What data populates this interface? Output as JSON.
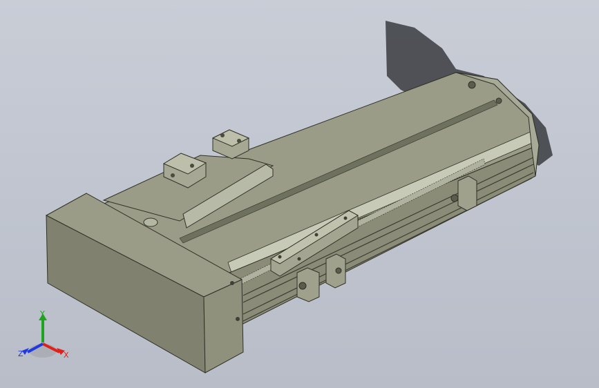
{
  "viewport": {
    "background_top": "#c9cdd6",
    "background_bottom": "#b9bdc8"
  },
  "model": {
    "body_color": "#8a8c78",
    "top_color": "#9a9c88",
    "face_color": "#7f816e",
    "edge_color": "#2f3026",
    "shadow_color": "#3a3c40"
  },
  "triad": {
    "x_label": "X",
    "y_label": "Y",
    "z_label": "Z",
    "x_color": "#e0201a",
    "y_color": "#1ea41e",
    "z_color": "#2038e0"
  }
}
